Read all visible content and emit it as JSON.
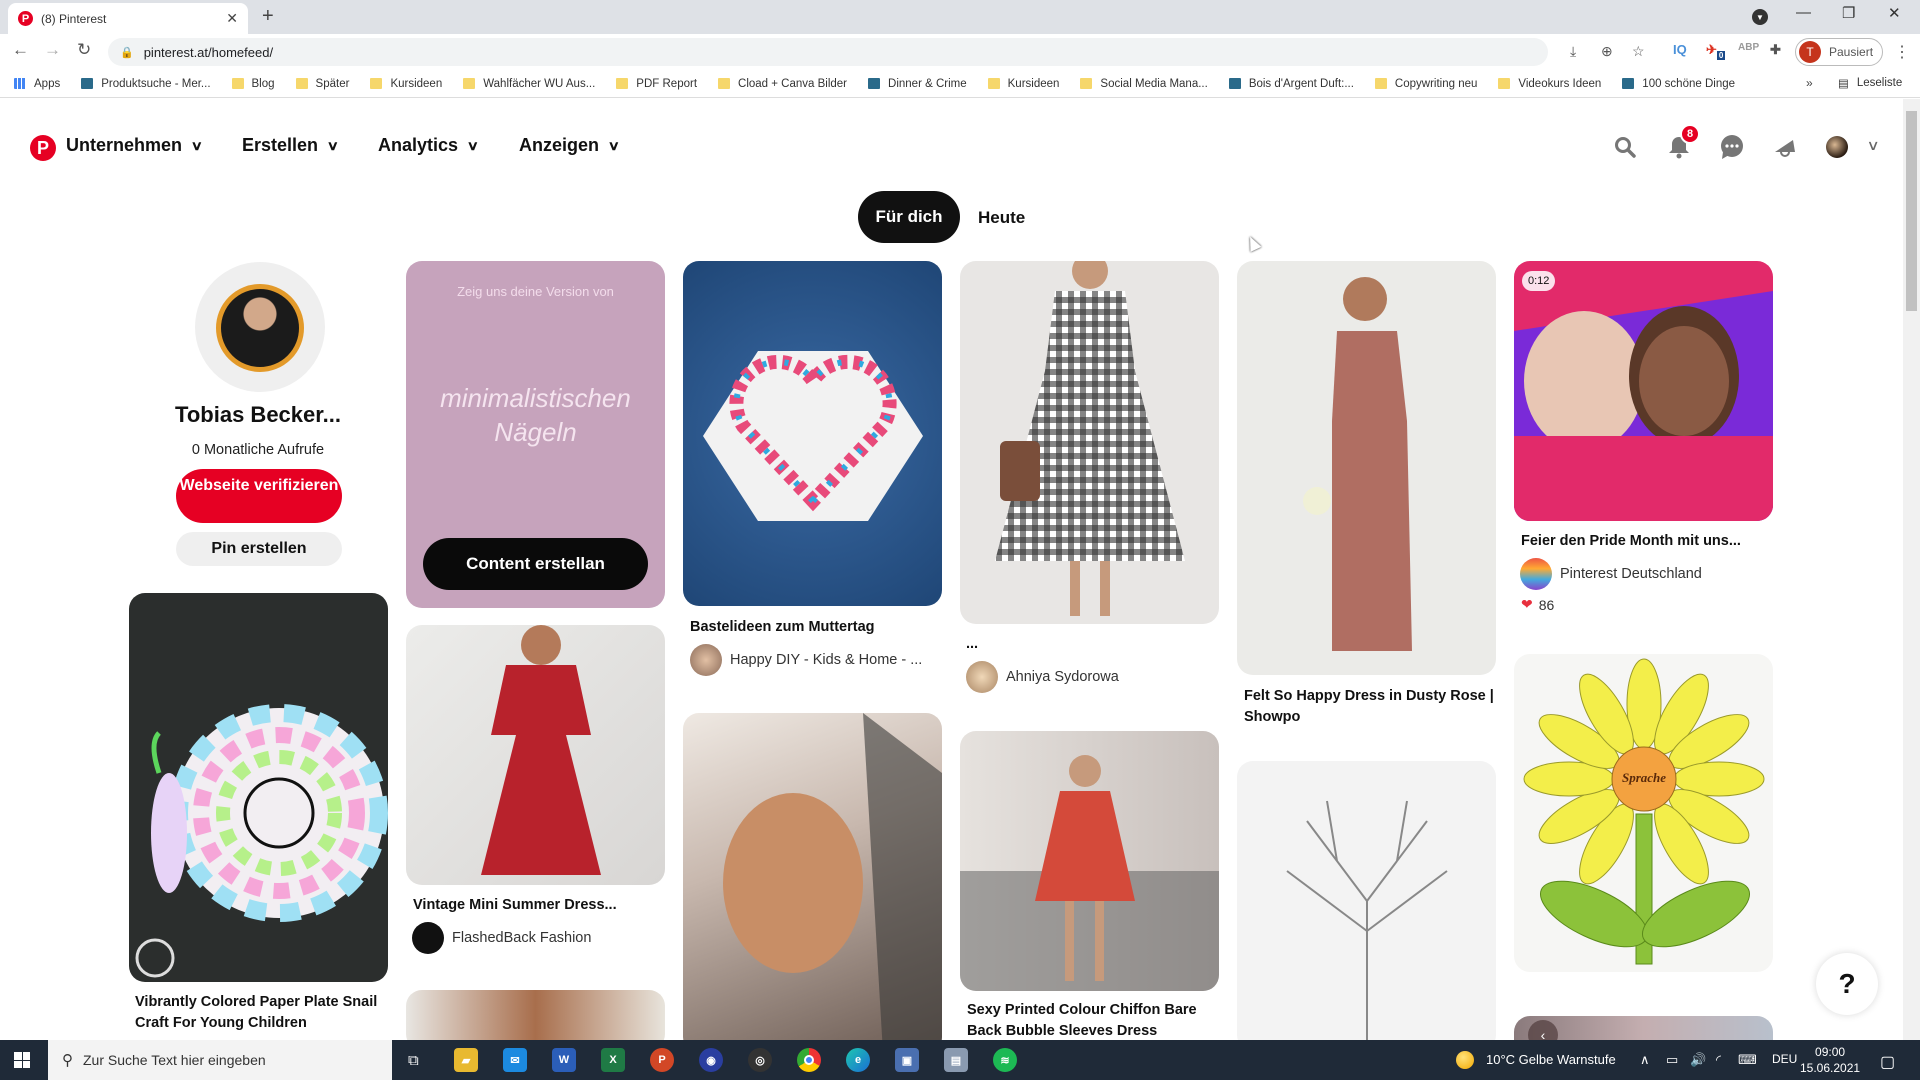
{
  "browser": {
    "tab_title": "(8) Pinterest",
    "url": "pinterest.at/homefeed/",
    "profile_label": "Pausiert",
    "profile_initial": "T",
    "extension_badge": "0",
    "bookmarks": [
      {
        "label": "Apps",
        "icon": "apps-grid-icon"
      },
      {
        "label": "Produktsuche - Mer...",
        "icon": "site-icon"
      },
      {
        "label": "Blog",
        "icon": "folder-icon"
      },
      {
        "label": "Später",
        "icon": "folder-icon"
      },
      {
        "label": "Kursideen",
        "icon": "folder-icon"
      },
      {
        "label": "Wahlfächer WU Aus...",
        "icon": "folder-icon"
      },
      {
        "label": "PDF Report",
        "icon": "folder-icon"
      },
      {
        "label": "Cload + Canva Bilder",
        "icon": "folder-icon"
      },
      {
        "label": "Dinner & Crime",
        "icon": "site-icon"
      },
      {
        "label": "Kursideen",
        "icon": "folder-icon"
      },
      {
        "label": "Social Media Mana...",
        "icon": "folder-icon"
      },
      {
        "label": "Bois d'Argent Duft:...",
        "icon": "site-icon"
      },
      {
        "label": "Copywriting neu",
        "icon": "folder-icon"
      },
      {
        "label": "Videokurs Ideen",
        "icon": "folder-icon"
      },
      {
        "label": "100 schöne Dinge",
        "icon": "site-icon"
      }
    ],
    "more_bookmarks": "»",
    "reading_list": "Leseliste"
  },
  "header": {
    "menus": [
      "Unternehmen",
      "Erstellen",
      "Analytics",
      "Anzeigen"
    ],
    "notification_count": "8"
  },
  "feed_tabs": {
    "active": "Für dich",
    "other": "Heute"
  },
  "profile": {
    "name": "Tobias Becker...",
    "monthly_views": "0 Monatliche Aufrufe",
    "verify_button": "Webseite verifizieren",
    "create_pin_button": "Pin erstellen"
  },
  "promo": {
    "subtitle": "Zeig uns deine Version von",
    "headline": "minimalistischen Nägeln",
    "cta": "Content erstellan"
  },
  "pins": [
    {
      "title": "Vibrantly Colored Paper Plate Snail Craft For Young Children"
    },
    {
      "title": "Vintage Mini Summer Dress...",
      "author": "FlashedBack Fashion"
    },
    {
      "title": "Bastelideen zum Muttertag",
      "author": "Happy DIY - Kids & Home - ..."
    },
    {
      "title": "...",
      "author": "Ahniya Sydorowa"
    },
    {
      "title": "Sexy Printed Colour Chiffon Bare Back Bubble Sleeves Dress"
    },
    {
      "title": "Felt So Happy Dress in Dusty Rose | Showpo"
    },
    {
      "title": "Feier den Pride Month mit uns...",
      "author": "Pinterest Deutschland",
      "likes": "86",
      "video_duration": "0:12"
    },
    {
      "diagram_center": "Sprache"
    }
  ],
  "help_button": "?",
  "taskbar": {
    "search_placeholder": "Zur Suche Text hier eingeben",
    "weather": "10°C  Gelbe Warnstufe",
    "language": "DEU",
    "time": "09:00",
    "date": "15.06.2021"
  }
}
